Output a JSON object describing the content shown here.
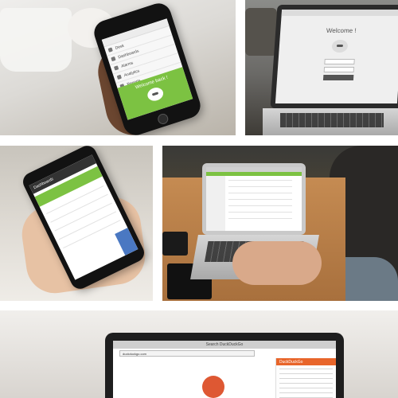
{
  "tiles": {
    "phone_menu": {
      "menu_items": [
        "Desk",
        "Dashboards",
        "Alarms",
        "Analytics",
        "Reports"
      ],
      "welcome_text": "Welcome back !"
    },
    "laptop_login": {
      "welcome_text": "Welcome !"
    },
    "android_app": {
      "header_text": "Dashboards"
    },
    "laptop_dashboard": {},
    "duckduckgo": {
      "tab_title": "Search DuckDuckGo",
      "address_bar": "duckduckgo.com",
      "panel_title": "DuckDuckGo"
    }
  },
  "colors": {
    "accent_green": "#7cc242",
    "accent_orange": "#e8652a",
    "duck_red": "#de5833"
  }
}
